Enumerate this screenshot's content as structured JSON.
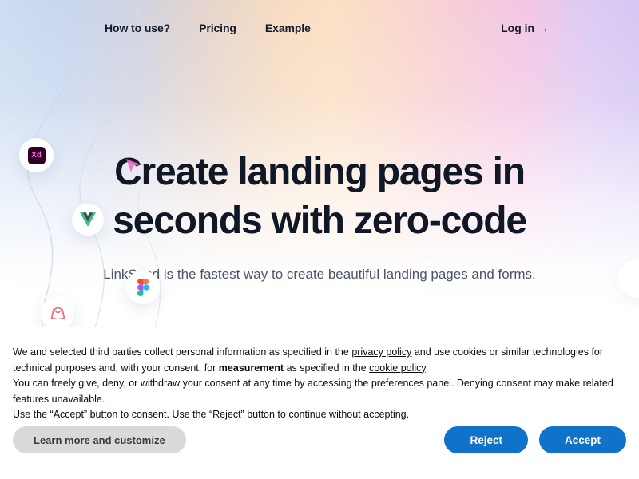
{
  "nav": {
    "links": [
      {
        "label": "How to use?"
      },
      {
        "label": "Pricing"
      },
      {
        "label": "Example"
      }
    ],
    "login_label": "Log in →"
  },
  "hero": {
    "headline_line1": "Create landing pages in",
    "headline_line2": "seconds with zero-code",
    "subheadline": "LinkSend is the fastest way to create beautiful landing pages and forms."
  },
  "floating_icons": [
    {
      "name": "adobe-xd-icon",
      "label": "Xd"
    },
    {
      "name": "vue-icon",
      "label": ""
    },
    {
      "name": "figma-icon",
      "label": ""
    },
    {
      "name": "sketch-icon",
      "label": ""
    }
  ],
  "cookie_banner": {
    "para1_a": "We and selected third parties collect personal information as specified in the ",
    "privacy_policy_link": "privacy policy",
    "para1_b": " and use cookies or similar technologies for technical purposes and, with your consent, for ",
    "measurement_bold": "measurement",
    "para1_c": " as specified in the ",
    "cookie_policy_link": "cookie policy",
    "para1_d": ".",
    "para2": "You can freely give, deny, or withdraw your consent at any time by accessing the preferences panel. Denying consent may make related features unavailable.",
    "para3": "Use the “Accept” button to consent. Use the “Reject” button to continue without accepting.",
    "learn_more_label": "Learn more and customize",
    "reject_label": "Reject",
    "accept_label": "Accept"
  },
  "colors": {
    "headline": "#101828",
    "primary_button": "#1072c8",
    "secondary_button": "#d9d9d9",
    "xd_purple": "#2e001f",
    "xd_pink": "#ff61f6",
    "vue_green": "#41b883",
    "vue_dark_green": "#35495e",
    "sketch_pink": "#e8707f"
  }
}
